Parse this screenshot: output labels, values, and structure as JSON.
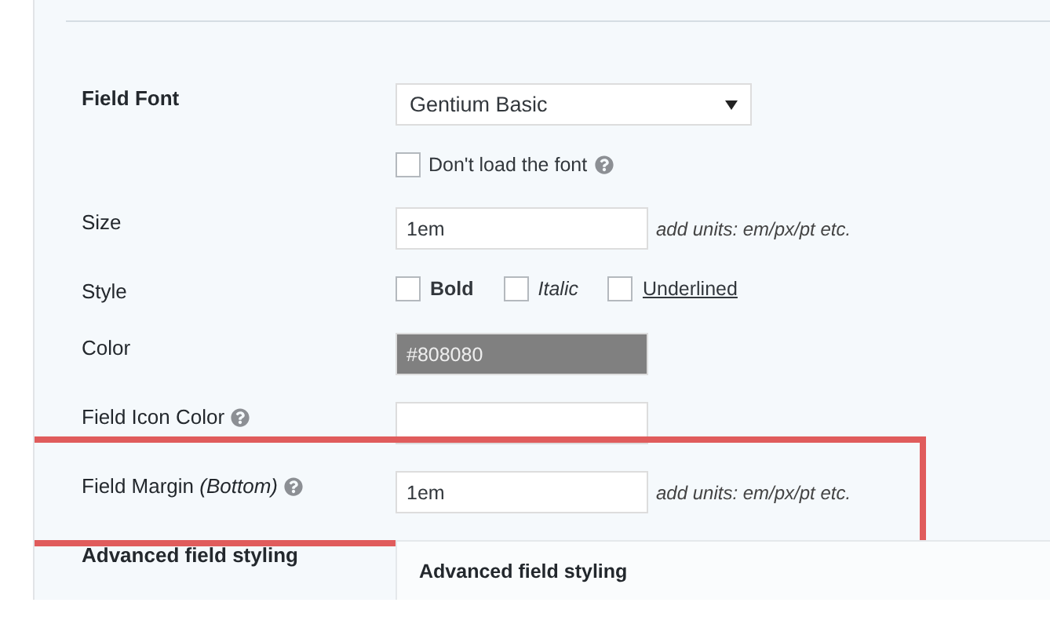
{
  "rows": [
    {
      "kind": "select",
      "label": "Field Font",
      "bold": true,
      "value": "Gentium Basic",
      "highlighted": false
    },
    {
      "kind": "checkbox",
      "text": "Don't load the font",
      "checked": false,
      "help": true,
      "highlighted": false
    },
    {
      "kind": "text",
      "label": "Size",
      "bold": false,
      "value": "1em",
      "hint": "add units: em/px/pt etc.",
      "highlighted": false
    },
    {
      "kind": "styles",
      "label": "Style",
      "bold": false,
      "options": [
        {
          "kind": "bold",
          "text": "Bold",
          "checked": false
        },
        {
          "kind": "italic",
          "text": "Italic",
          "checked": false
        },
        {
          "kind": "underline",
          "text": "Underlined",
          "checked": false
        }
      ],
      "highlighted": false
    },
    {
      "kind": "color",
      "label": "Color",
      "bold": false,
      "value": "#808080",
      "color": "#808080",
      "highlighted": false
    },
    {
      "kind": "color",
      "label": "Field Icon Color",
      "bold": false,
      "help": true,
      "highlighted": false
    },
    {
      "kind": "text",
      "label": "Field Margin *(Bottom)*",
      "bold": false,
      "help": true,
      "value": "1em",
      "hint": "add units: em/px/pt etc.",
      "highlighted": true
    },
    {
      "kind": "section",
      "label": "Advanced field styling",
      "bold": true,
      "title": "Advanced field styling",
      "highlighted": false
    }
  ]
}
